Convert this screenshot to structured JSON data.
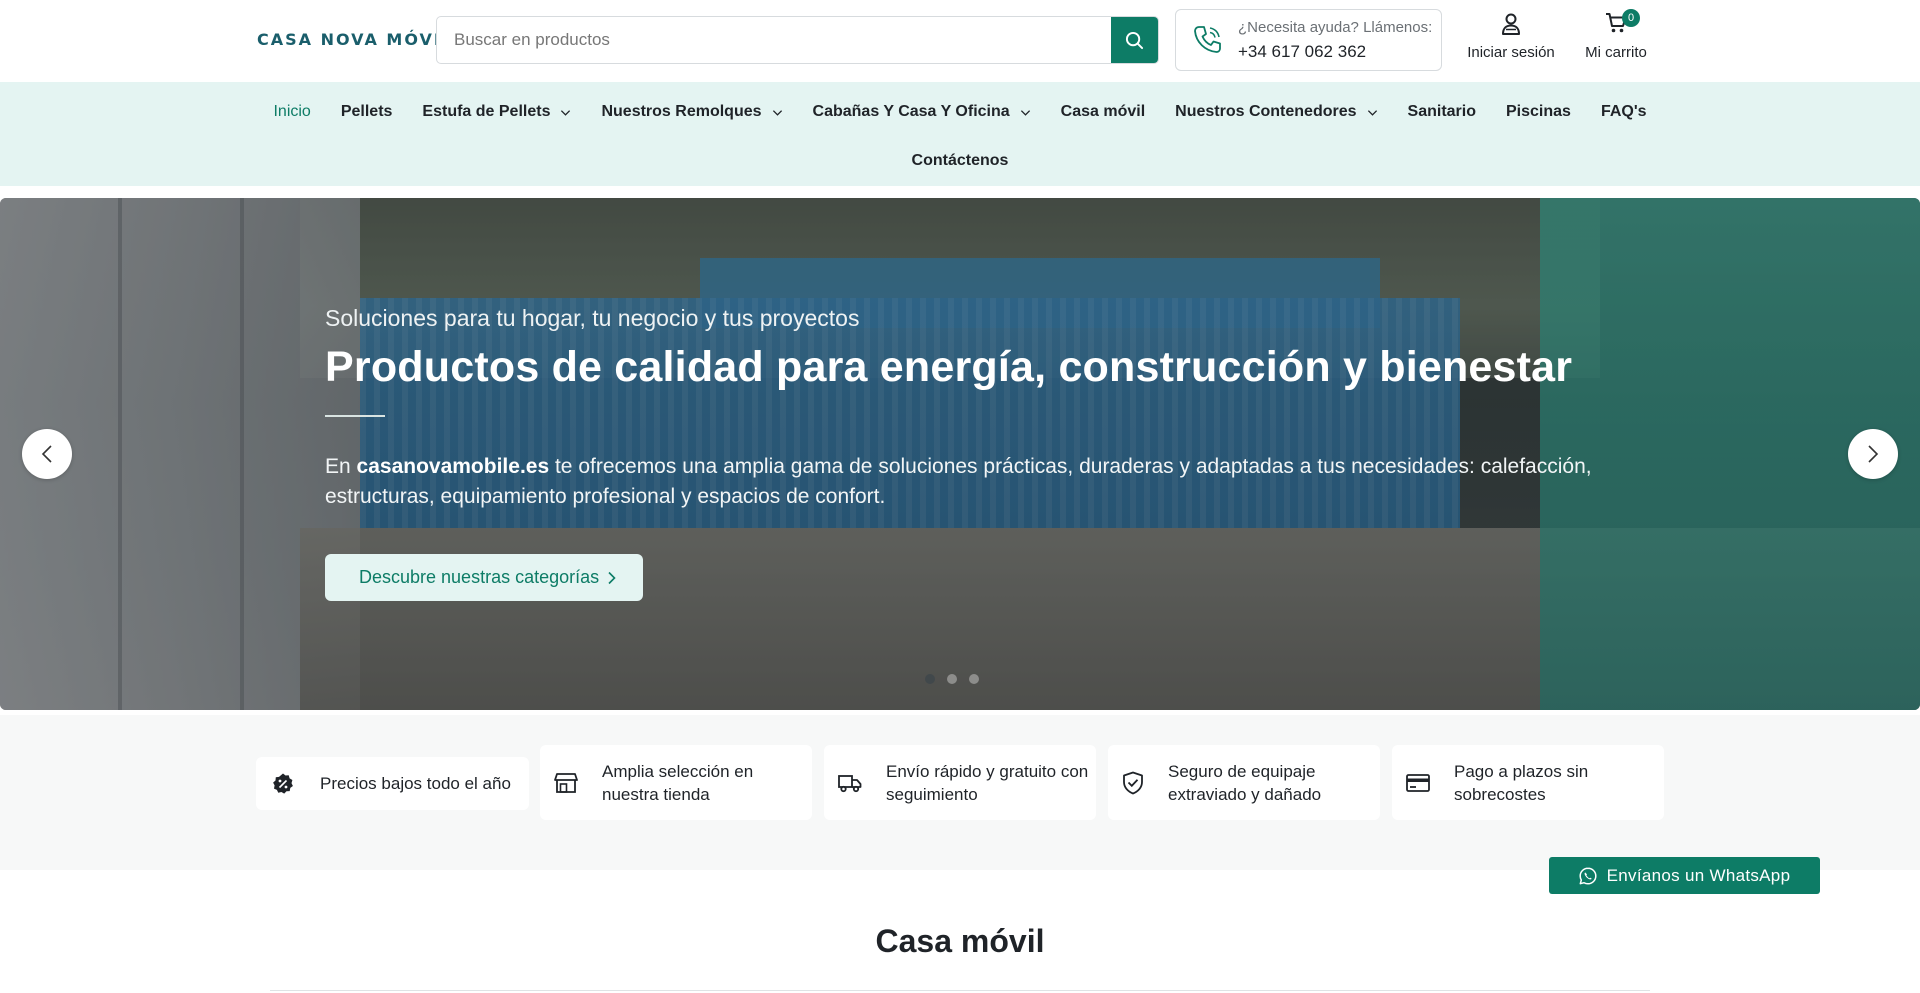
{
  "header": {
    "logo": "CASA NOVA MÓVIL",
    "search": {
      "placeholder": "Buscar en productos",
      "value": ""
    },
    "help": {
      "question": "¿Necesita ayuda? Llámenos:",
      "phone": "+34 617 062 362"
    },
    "account_label": "Iniciar sesión",
    "cart": {
      "label": "Mi carrito",
      "count": "0"
    }
  },
  "nav": {
    "row1": [
      {
        "label": "Inicio",
        "active": true
      },
      {
        "label": "Pellets"
      },
      {
        "label": "Estufa de Pellets",
        "dropdown": true
      },
      {
        "label": "Nuestros Remolques",
        "dropdown": true
      },
      {
        "label": "Cabañas Y Casa Y Oficina",
        "dropdown": true
      },
      {
        "label": "Casa móvil"
      },
      {
        "label": "Nuestros Contenedores",
        "dropdown": true
      },
      {
        "label": "Sanitario"
      },
      {
        "label": "Piscinas"
      },
      {
        "label": "FAQ's"
      }
    ],
    "row2": [
      {
        "label": "Contáctenos"
      }
    ]
  },
  "hero": {
    "subtitle": "Soluciones para tu hogar, tu negocio y tus proyectos",
    "title": "Productos de calidad para energía, construcción y bienestar",
    "desc_prefix": "En ",
    "desc_brand": "casanovamobile.es",
    "desc_rest": " te ofrecemos una amplia gama de soluciones prácticas, duraderas y adaptadas a tus necesidades: calefacción, estructuras, equipamiento profesional y espacios de confort.",
    "cta_icon": "",
    "cta_label": "Descubre nuestras categorías",
    "slides": 3,
    "active_slide": 1
  },
  "features": [
    {
      "icon": "badge-percent-icon",
      "text": "Precios bajos todo el año"
    },
    {
      "icon": "store-icon",
      "text": "Amplia selección en nuestra tienda"
    },
    {
      "icon": "truck-icon",
      "text": "Envío rápido y gratuito con seguimiento"
    },
    {
      "icon": "shield-check-icon",
      "text": "Seguro de equipaje extraviado y dañado"
    },
    {
      "icon": "credit-card-icon",
      "text": "Pago a plazos sin sobrecostes"
    }
  ],
  "whatsapp_label": "Envíanos un WhatsApp",
  "section": {
    "icon": "",
    "title": "Casa móvil"
  },
  "colors": {
    "accent": "#0d7c66",
    "nav_bg": "#e4f4f2",
    "logo": "#1a5e6b"
  }
}
